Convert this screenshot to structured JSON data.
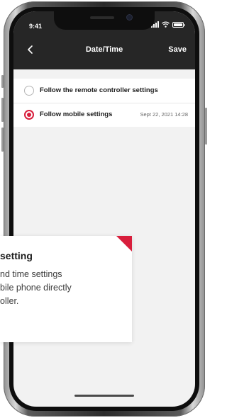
{
  "status_bar": {
    "time": "9:41",
    "icons": [
      "signal-icon",
      "wifi-icon",
      "battery-icon"
    ]
  },
  "navbar": {
    "back_icon": "chevron-left-icon",
    "title": "Date/Time",
    "save_label": "Save"
  },
  "options": [
    {
      "label": "Follow the remote controller settings",
      "value": "",
      "selected": false
    },
    {
      "label": "Follow mobile settings",
      "value": "Sept 22, 2021 14:28",
      "selected": true
    }
  ],
  "callout": {
    "title": "setting",
    "lines": [
      "nd time settings",
      "bile phone directly",
      "oller."
    ]
  },
  "colors": {
    "accent": "#d81e3c",
    "navbar": "#262626",
    "screen_bg": "#f2f2f2"
  }
}
